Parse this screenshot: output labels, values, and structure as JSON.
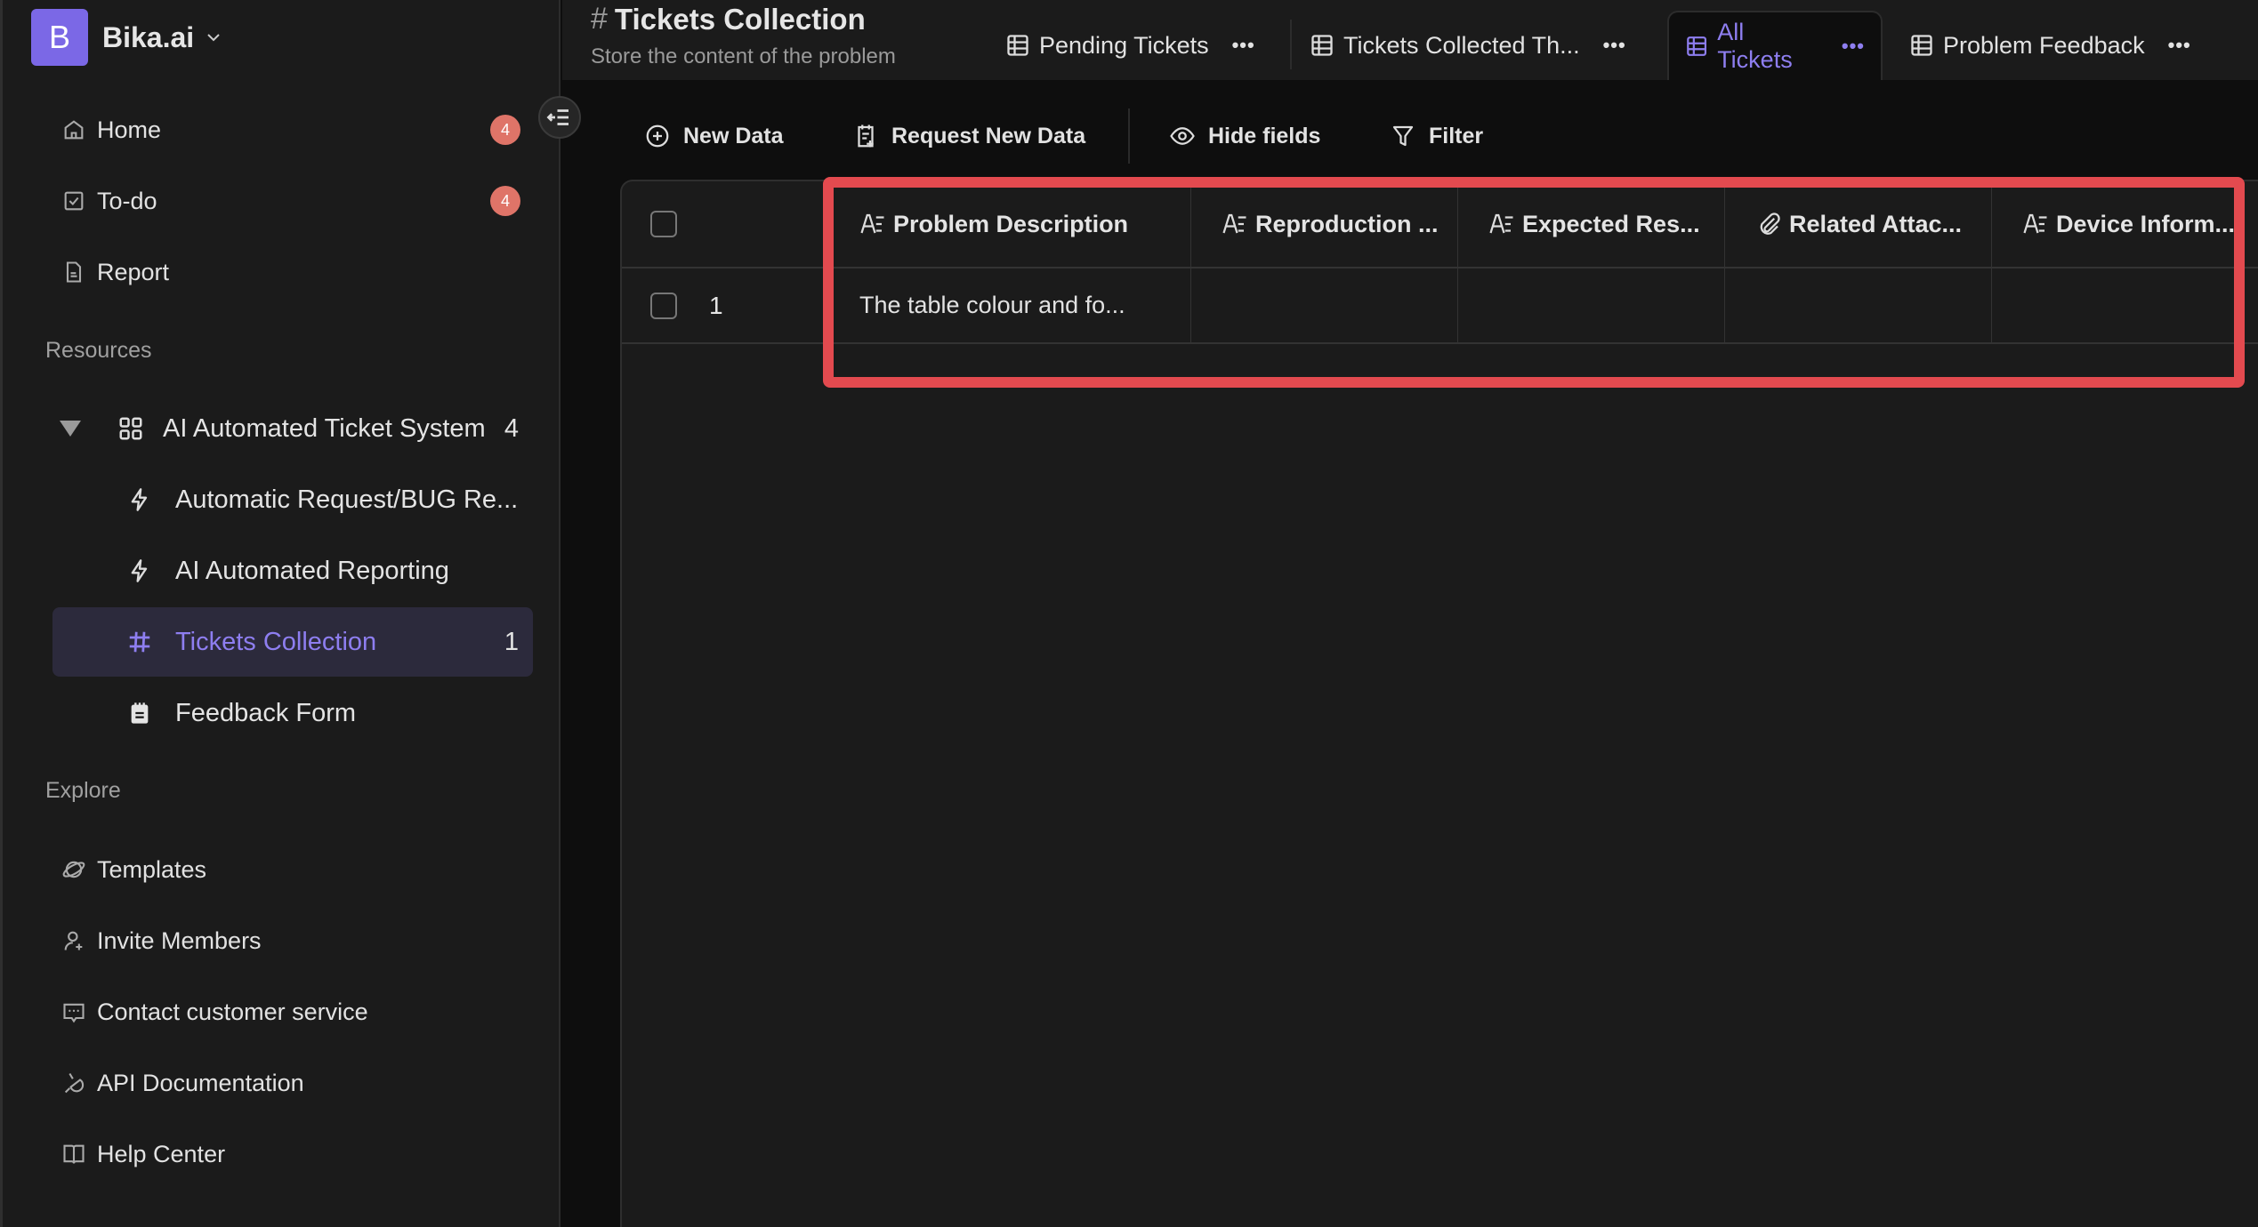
{
  "workspace": {
    "logo_letter": "B",
    "name": "Bika.ai",
    "brand_color": "#7b68e6"
  },
  "sidebar": {
    "nav": [
      {
        "label": "Home",
        "icon": "home-icon",
        "badge": "4"
      },
      {
        "label": "To-do",
        "icon": "checkbox-icon",
        "badge": "4"
      },
      {
        "label": "Report",
        "icon": "document-icon"
      }
    ],
    "resources_label": "Resources",
    "tree": {
      "folder": {
        "label": "AI Automated Ticket System",
        "count": "4",
        "icon": "grid-icon"
      },
      "children": [
        {
          "label": "Automatic Request/BUG Re...",
          "icon": "lightning-icon"
        },
        {
          "label": "AI Automated Reporting",
          "icon": "lightning-icon"
        },
        {
          "label": "Tickets Collection",
          "icon": "hash-icon",
          "count": "1",
          "selected": true
        },
        {
          "label": "Feedback Form",
          "icon": "form-icon"
        }
      ]
    },
    "explore_label": "Explore",
    "explore": [
      {
        "label": "Templates",
        "icon": "planet-icon"
      },
      {
        "label": "Invite Members",
        "icon": "user-plus-icon"
      },
      {
        "label": "Contact customer service",
        "icon": "chat-icon"
      },
      {
        "label": "API Documentation",
        "icon": "plug-icon"
      },
      {
        "label": "Help Center",
        "icon": "book-icon"
      }
    ]
  },
  "header": {
    "title": "Tickets Collection",
    "subtitle": "Store the content of the problem",
    "tabs": [
      {
        "label": "Pending Tickets",
        "active": false
      },
      {
        "label": "Tickets Collected Th...",
        "active": false
      },
      {
        "label": "All Tickets",
        "active": true
      },
      {
        "label": "Problem Feedback",
        "active": false
      }
    ],
    "more_glyph": "•••"
  },
  "toolbar": {
    "new_data": "New Data",
    "request_new_data": "Request New Data",
    "hide_fields": "Hide fields",
    "filter": "Filter"
  },
  "table": {
    "columns": [
      {
        "label": "Problem Description",
        "type": "text"
      },
      {
        "label": "Reproduction ...",
        "type": "text"
      },
      {
        "label": "Expected Res...",
        "type": "text"
      },
      {
        "label": "Related Attac...",
        "type": "attachment"
      },
      {
        "label": "Device Inform...",
        "type": "text"
      }
    ],
    "rows": [
      {
        "num": "1",
        "cells": [
          "The table colour and fo...",
          "",
          "",
          "",
          ""
        ]
      }
    ]
  },
  "colors": {
    "accent": "#8e7ef0",
    "badge": "#df7468",
    "highlight": "#e34a4f"
  }
}
